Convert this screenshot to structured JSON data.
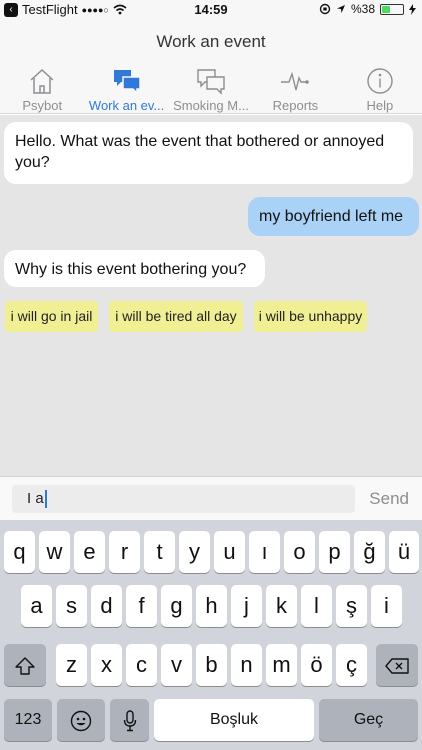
{
  "status_bar": {
    "carrier": "TestFlight",
    "signal": "●●●●○",
    "time": "14:59",
    "battery": "%38",
    "battery_level": 0.38
  },
  "header": {
    "title": "Work an event"
  },
  "tabs": [
    {
      "label": "Psybot",
      "icon": "home-icon"
    },
    {
      "label": "Work an ev...",
      "icon": "chat-bubbles-icon",
      "active": true
    },
    {
      "label": "Smoking M...",
      "icon": "chat-outline-icon"
    },
    {
      "label": "Reports",
      "icon": "heartbeat-icon"
    },
    {
      "label": "Help",
      "icon": "info-icon"
    }
  ],
  "chat": {
    "messages": [
      {
        "from": "bot",
        "text": "Hello. What was the event that bothered or annoyed you?"
      },
      {
        "from": "user",
        "text": "my boyfriend left me"
      },
      {
        "from": "bot",
        "text": "Why is this event bothering you?"
      }
    ],
    "quick_replies": [
      "i will go in jail",
      "i will be tired all day",
      "i will be unhappy"
    ]
  },
  "input": {
    "value": "I a",
    "send_label": "Send"
  },
  "keyboard": {
    "row1": [
      "q",
      "w",
      "e",
      "r",
      "t",
      "y",
      "u",
      "ı",
      "o",
      "p",
      "ğ",
      "ü"
    ],
    "row2": [
      "a",
      "s",
      "d",
      "f",
      "g",
      "h",
      "j",
      "k",
      "l",
      "ş",
      "i"
    ],
    "row3": [
      "z",
      "x",
      "c",
      "v",
      "b",
      "n",
      "m",
      "ö",
      "ç"
    ],
    "key_123": "123",
    "key_space": "Boşluk",
    "key_return": "Geç"
  },
  "colors": {
    "accent": "#2f7ad8",
    "user_bubble": "#a9d2f6",
    "quick_reply": "#f1ef94",
    "chat_background": "#e5e5e5"
  }
}
